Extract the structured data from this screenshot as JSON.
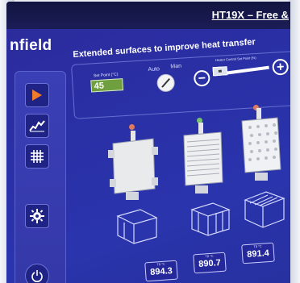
{
  "window": {
    "title": "HT19X – Free &"
  },
  "brand": {
    "text": "nfield"
  },
  "page": {
    "heading": "Extended surfaces to improve heat transfer"
  },
  "controls": {
    "setpoint_label": "Set Point (°C)",
    "setpoint_value": "45",
    "mode_auto": "Auto",
    "mode_man": "Man",
    "heater_label": "Heater Control Set Point (%)",
    "minus": "−",
    "plus": "+"
  },
  "sidebar": {
    "items": [
      {
        "icon": "play-icon"
      },
      {
        "icon": "graph-icon"
      },
      {
        "icon": "grid-icon"
      },
      {
        "icon": "gear-icon"
      },
      {
        "icon": "power-icon"
      }
    ]
  },
  "samples": [
    {
      "led_color": "#e07a5f",
      "readout_label": "T8 °C",
      "readout_value": "894.3"
    },
    {
      "led_color": "#78c26f",
      "readout_label": "T8 °C",
      "readout_value": "890.7"
    },
    {
      "led_color": "#e07a5f",
      "readout_label": "T8 °C",
      "readout_value": "891.4"
    }
  ],
  "colors": {
    "accent_orange": "#f07b2a",
    "screen_blue": "#2a30a6",
    "setpoint_green": "#6f9f3f"
  }
}
